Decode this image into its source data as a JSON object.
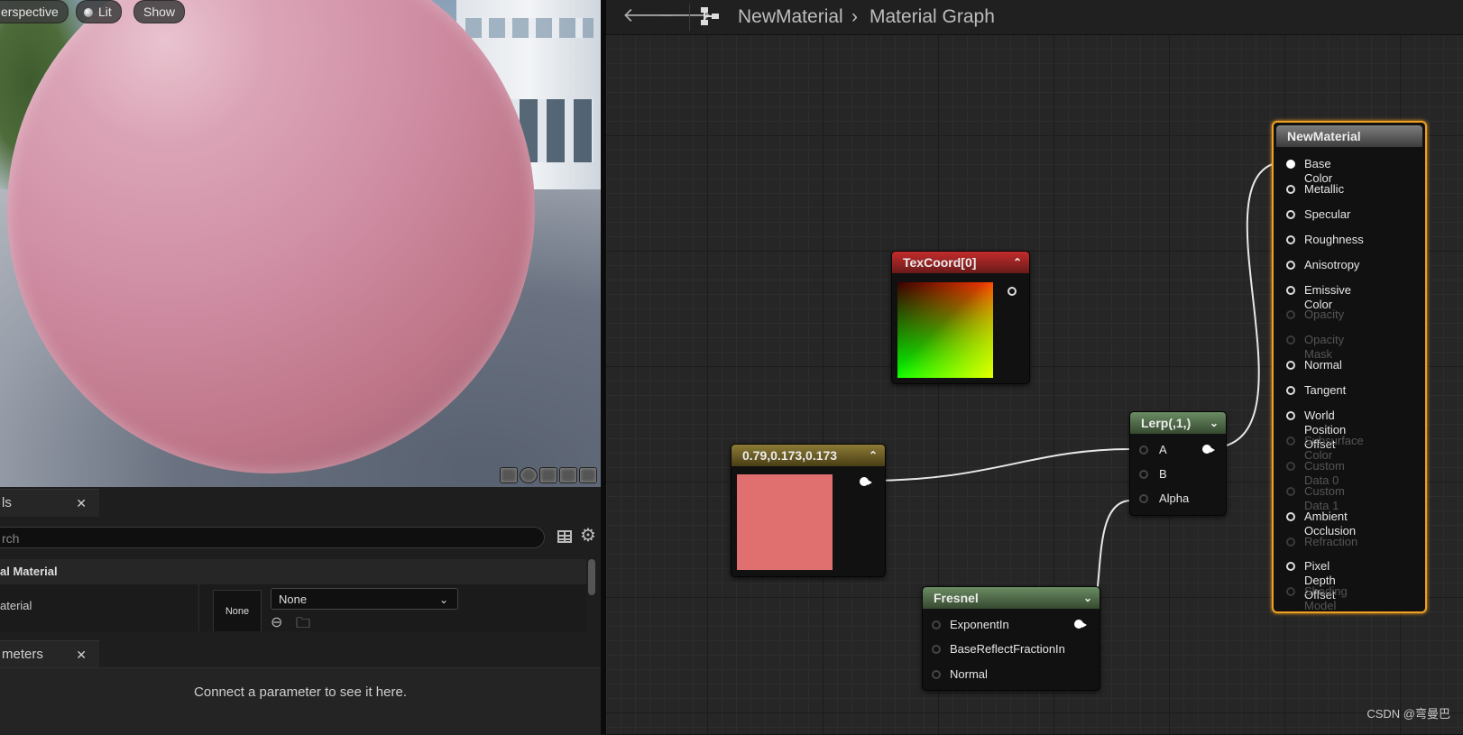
{
  "viewport": {
    "buttons": {
      "perspective": "erspective",
      "lit": "Lit",
      "show": "Show"
    }
  },
  "details_panel": {
    "tab_label": "ls",
    "close": "✕",
    "search_placeholder": "rch",
    "section_title": "al Material",
    "property_name": "aterial",
    "thumbnail_label": "None",
    "combo_value": "None"
  },
  "parameters_panel": {
    "tab_label": "meters",
    "close": "✕",
    "message": "Connect a parameter to see it here."
  },
  "graph": {
    "breadcrumb": [
      "NewMaterial",
      "Material Graph"
    ],
    "breadcrumb_separator": "›",
    "nodes": {
      "texcoord": {
        "title": "TexCoord[0]"
      },
      "constant": {
        "title": "0.79,0.173,0.173",
        "color": "#e07070"
      },
      "lerp": {
        "title": "Lerp(,1,)",
        "inputs": [
          "A",
          "B",
          "Alpha"
        ]
      },
      "fresnel": {
        "title": "Fresnel",
        "inputs": [
          "ExponentIn",
          "BaseReflectFractionIn",
          "Normal"
        ]
      },
      "material": {
        "title": "NewMaterial",
        "inputs": [
          {
            "label": "Base Color",
            "enabled": true
          },
          {
            "label": "Metallic",
            "enabled": true
          },
          {
            "label": "Specular",
            "enabled": true
          },
          {
            "label": "Roughness",
            "enabled": true
          },
          {
            "label": "Anisotropy",
            "enabled": true
          },
          {
            "label": "Emissive Color",
            "enabled": true
          },
          {
            "label": "Opacity",
            "enabled": false
          },
          {
            "label": "Opacity Mask",
            "enabled": false
          },
          {
            "label": "Normal",
            "enabled": true
          },
          {
            "label": "Tangent",
            "enabled": true
          },
          {
            "label": "World Position Offset",
            "enabled": true
          },
          {
            "label": "Subsurface Color",
            "enabled": false
          },
          {
            "label": "Custom Data 0",
            "enabled": false
          },
          {
            "label": "Custom Data 1",
            "enabled": false
          },
          {
            "label": "Ambient Occlusion",
            "enabled": true
          },
          {
            "label": "Refraction",
            "enabled": false
          },
          {
            "label": "Pixel Depth Offset",
            "enabled": true
          },
          {
            "label": "Shading Model",
            "enabled": false
          }
        ]
      }
    }
  },
  "watermark": "CSDN @弯曼巴"
}
